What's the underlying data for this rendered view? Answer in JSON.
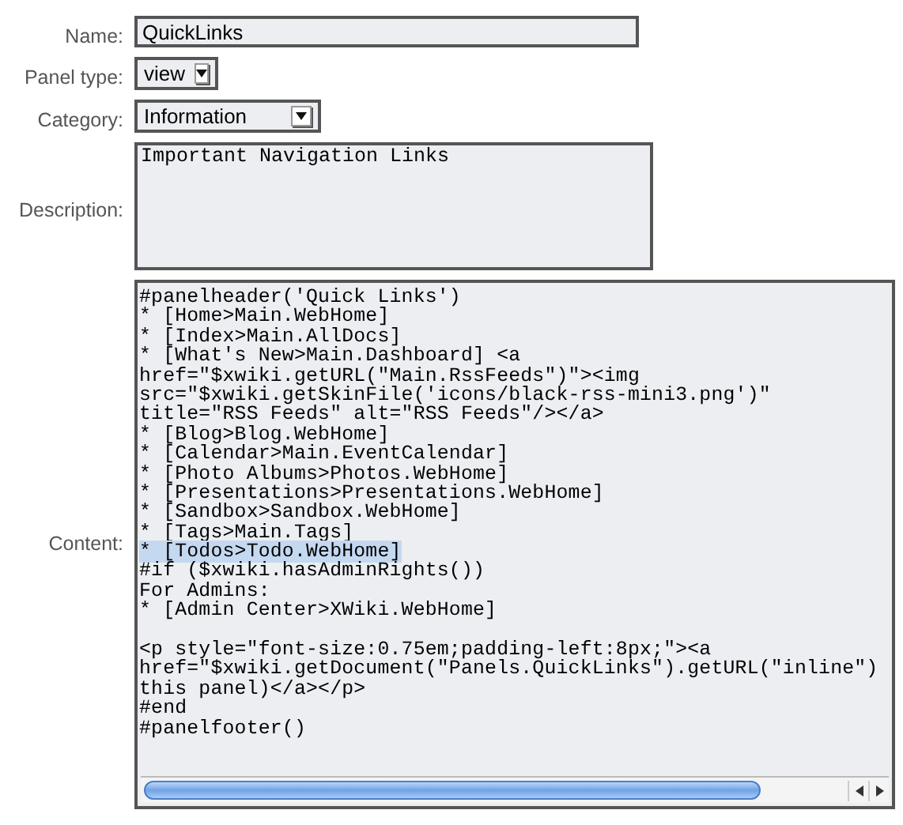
{
  "fields": [
    {
      "kind": "text",
      "label": "Name:",
      "value": "QuickLinks"
    },
    {
      "kind": "select",
      "label": "Panel type:",
      "value": "view"
    },
    {
      "kind": "select",
      "label": "Category:",
      "value": "Information"
    },
    {
      "kind": "textarea",
      "label": "Description:",
      "value": "Important Navigation Links"
    },
    {
      "kind": "code",
      "label": "Content:",
      "lines": [
        {
          "text": "#panelheader('Quick Links')",
          "selected": false
        },
        {
          "text": "* [Home>Main.WebHome]",
          "selected": false
        },
        {
          "text": "* [Index>Main.AllDocs]",
          "selected": false
        },
        {
          "text": "* [What's New>Main.Dashboard] <a",
          "selected": false
        },
        {
          "text": "href=\"$xwiki.getURL(\"Main.RssFeeds\")\"><img",
          "selected": false
        },
        {
          "text": "src=\"$xwiki.getSkinFile('icons/black-rss-mini3.png')\"",
          "selected": false
        },
        {
          "text": "title=\"RSS Feeds\" alt=\"RSS Feeds\"/></a>",
          "selected": false
        },
        {
          "text": "* [Blog>Blog.WebHome]",
          "selected": false
        },
        {
          "text": "* [Calendar>Main.EventCalendar]",
          "selected": false
        },
        {
          "text": "* [Photo Albums>Photos.WebHome]",
          "selected": false
        },
        {
          "text": "* [Presentations>Presentations.WebHome]",
          "selected": false
        },
        {
          "text": "* [Sandbox>Sandbox.WebHome]",
          "selected": false
        },
        {
          "text": "* [Tags>Main.Tags]",
          "selected": false
        },
        {
          "text": "* [Todos>Todo.WebHome]",
          "selected": true
        },
        {
          "text": "#if ($xwiki.hasAdminRights())",
          "selected": false
        },
        {
          "text": "For Admins:",
          "selected": false
        },
        {
          "text": "* [Admin Center>XWiki.WebHome]",
          "selected": false
        },
        {
          "text": "<p style=\"font-size:0.75em;padding-left:8px;\"><a",
          "selected": false,
          "blank_line_before": true
        },
        {
          "text": "href=\"$xwiki.getDocument(\"Panels.QuickLinks\").getURL(\"inline\")",
          "selected": false
        },
        {
          "text": "this panel)</a></p>",
          "selected": false
        },
        {
          "text": "#end",
          "selected": false
        },
        {
          "text": "#panelfooter()",
          "selected": false
        }
      ]
    }
  ]
}
